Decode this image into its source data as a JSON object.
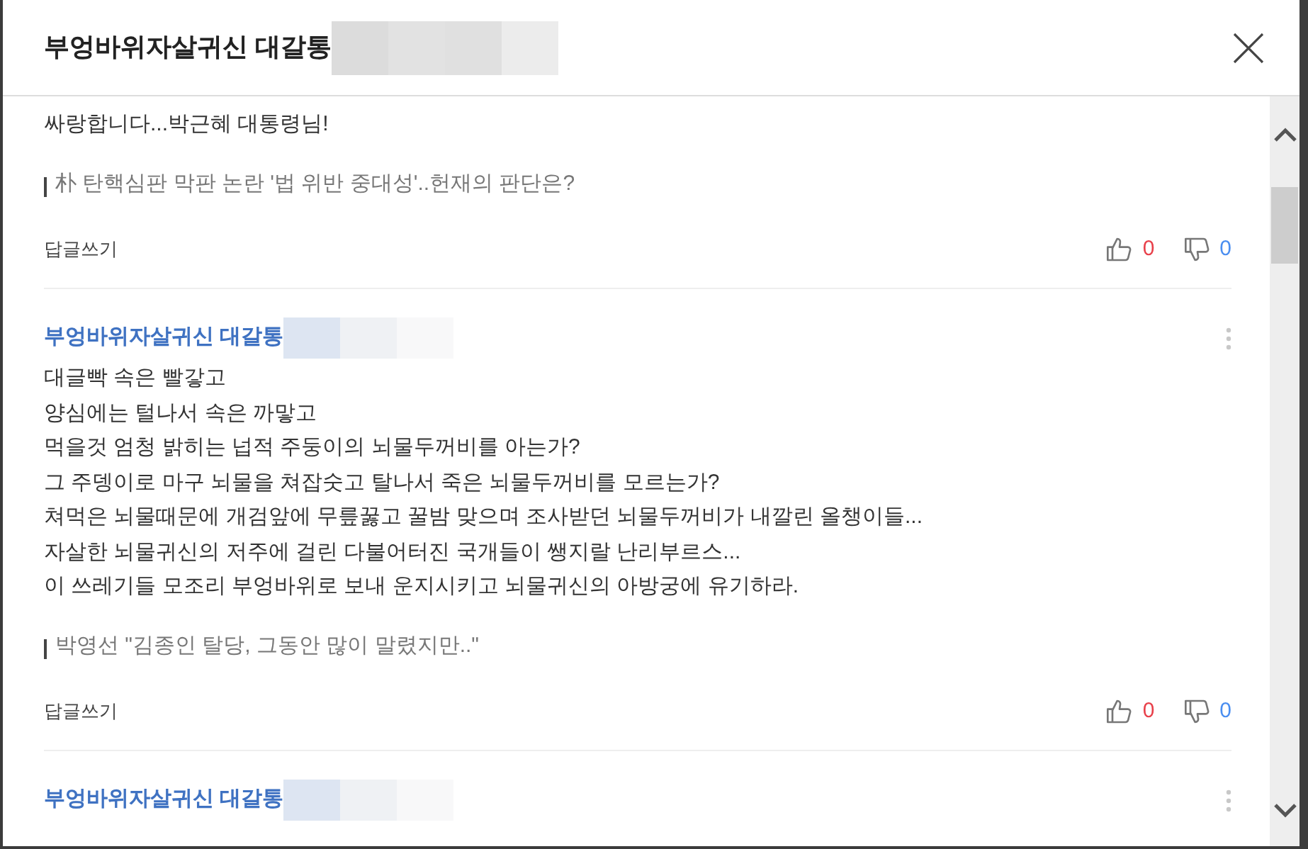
{
  "dialog": {
    "title": "부엉바위자살귀신 대갈통",
    "title_redacted": true
  },
  "comments": [
    {
      "lines": [
        "싸랑합니다...박근혜 대통령님!"
      ],
      "article_link": "朴 탄핵심판 막판 논란 '법 위반 중대성'..헌재의 판단은?",
      "reply_label": "답글쓰기",
      "likes": "0",
      "dislikes": "0"
    },
    {
      "author": "부엉바위자살귀신 대갈통",
      "redacted": true,
      "lines": [
        "대글빡 속은 빨갛고",
        "양심에는 털나서 속은 까맣고",
        "먹을것 엄청 밝히는 넙적 주둥이의 뇌물두꺼비를 아는가?",
        "그 주뎅이로 마구 뇌물을 쳐잡숫고 탈나서 죽은 뇌물두꺼비를 모르는가?",
        "쳐먹은 뇌물때문에 개검앞에 무릎꿇고 꿀밤 맞으며 조사받던 뇌물두꺼비가 내깔린 올챙이들...",
        "자살한 뇌물귀신의 저주에 걸린 다불어터진 국개들이 쌩지랄 난리부르스...",
        "이 쓰레기들 모조리 부엉바위로 보내 운지시키고 뇌물귀신의 아방궁에 유기하라."
      ],
      "article_link": "박영선 \"김종인 탈당, 그동안 많이 말렸지만..\"",
      "reply_label": "답글쓰기",
      "likes": "0",
      "dislikes": "0",
      "has_menu": true
    },
    {
      "author": "부엉바위자살귀신 대갈통",
      "redacted": true,
      "has_menu": true
    }
  ]
}
